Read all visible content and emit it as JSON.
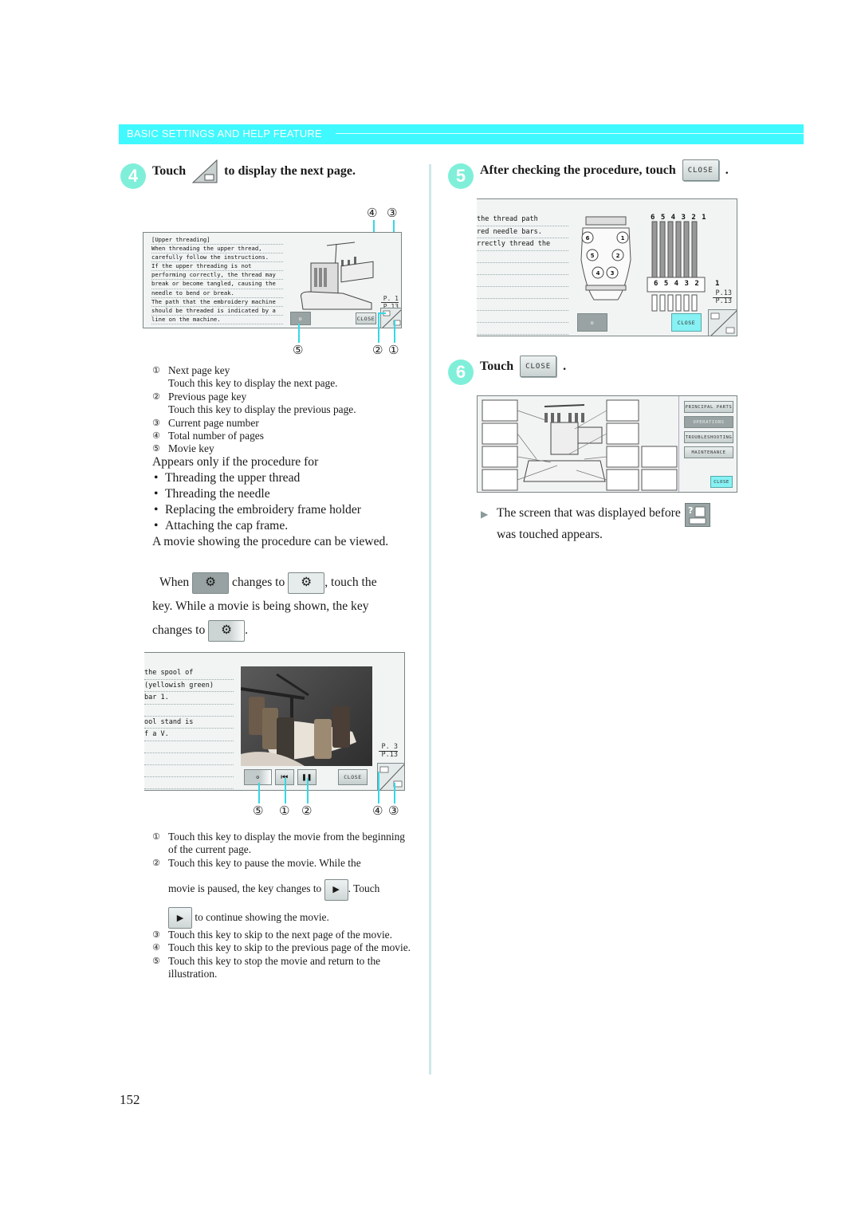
{
  "header": {
    "section_title": "BASIC SETTINGS AND HELP FEATURE"
  },
  "step4": {
    "number": "4",
    "text_before": "Touch",
    "text_after": "to display the next page.",
    "screen": {
      "lines": [
        "[Upper threading]",
        " When threading the upper thread,",
        "carefully follow the instructions.",
        "If the upper threading is not",
        "performing correctly, the thread may",
        "break or become tangled, causing the",
        "needle to bend or break.",
        " The path that the embroidery machine",
        "should be threaded is indicated by a",
        "line on the machine."
      ],
      "current_page": "P. 1",
      "total_pages": "P.13",
      "close_label": "CLOSE"
    },
    "callouts_top": [
      "④",
      "③"
    ],
    "callouts_bottom": [
      "⑤",
      "②",
      "①"
    ],
    "legend": [
      {
        "num": "①",
        "title": "Next page key",
        "desc": "Touch this key to display the next page."
      },
      {
        "num": "②",
        "title": "Previous page key",
        "desc": "Touch this key to display the previous page."
      },
      {
        "num": "③",
        "title": "Current page number",
        "desc": ""
      },
      {
        "num": "④",
        "title": "Total number of pages",
        "desc": ""
      },
      {
        "num": "⑤",
        "title": "Movie key",
        "desc": ""
      }
    ],
    "appears_intro": "Appears only if the procedure for",
    "appears_bullets": [
      "Threading the upper thread",
      "Threading the needle",
      "Replacing the embroidery frame holder",
      "Attaching the cap frame."
    ],
    "appears_outro": "A movie showing the procedure can be viewed.",
    "when_text": {
      "part1": "When",
      "part2": "changes to",
      "part3": ", touch the",
      "part4": "key. While a movie is being shown, the key",
      "part5": "changes to",
      "part6": "."
    },
    "movie_screen": {
      "lines": [
        " the spool of",
        " (yellowish green)",
        "bar 1.",
        "",
        "ool stand is",
        "f a V."
      ],
      "current_page": "P. 3",
      "total_pages": "P.13",
      "close_label": "CLOSE"
    },
    "movie_callouts": [
      "⑤",
      "①",
      "②",
      "④",
      "③"
    ],
    "movie_legend": [
      {
        "num": "①",
        "text": "Touch this key to display the movie from the beginning of the current page."
      },
      {
        "num": "②",
        "text": "Touch this key to pause the movie. While the",
        "text2": "movie is paused, the key changes to",
        "text3": ". Touch",
        "text4": "to continue showing the movie."
      },
      {
        "num": "③",
        "text": "Touch this key to skip to the next page of the movie."
      },
      {
        "num": "④",
        "text": "Touch this key to skip to the previous page of the movie."
      },
      {
        "num": "⑤",
        "text": "Touch this key to stop the movie and return to the illustration."
      }
    ]
  },
  "step5": {
    "number": "5",
    "text": "After checking the procedure, touch",
    "close_label": "CLOSE",
    "screen": {
      "lines": [
        " the thread path",
        "red needle bars.",
        "rrectly thread the"
      ],
      "needle_numbers_top": "6 5 4 3 2 1",
      "needle_numbers_mid": "6 5 4 3 2   1",
      "spool_numbers": [
        "6",
        "5",
        "4",
        "1",
        "2",
        "3"
      ],
      "current_page": "P.13",
      "total_pages": "P.13",
      "close_label": "CLOSE"
    }
  },
  "step6": {
    "number": "6",
    "text": "Touch",
    "close_label": "CLOSE",
    "screen": {
      "menu": [
        "PRINCIPAL PARTS",
        "OPERATIONS",
        "TROUBLESHOOTING",
        "MAINTENANCE"
      ],
      "active_menu": "OPERATIONS",
      "close_label": "CLOSE"
    },
    "result": "The screen that was displayed before",
    "result2": "was touched appears."
  },
  "page_number": "152",
  "colors": {
    "accent_cyan": "#3ff9ff",
    "badge_green": "#7fefd9",
    "callout_line": "#35d8e6"
  }
}
